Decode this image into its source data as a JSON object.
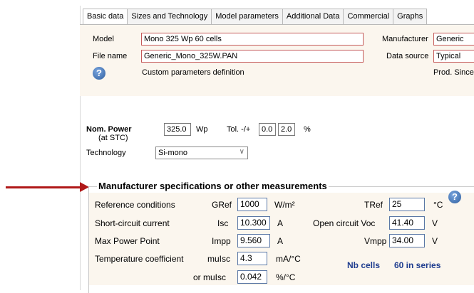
{
  "tabs": [
    "Basic data",
    "Sizes and Technology",
    "Model parameters",
    "Additional Data",
    "Commercial",
    "Graphs"
  ],
  "header": {
    "model_label": "Model",
    "model_value": "Mono 325 Wp  60 cells",
    "manufacturer_label": "Manufacturer",
    "manufacturer_value": "Generic",
    "file_label": "File name",
    "file_value": "Generic_Mono_325W.PAN",
    "data_source_label": "Data source",
    "data_source_value": "Typical",
    "custom_params_label": "Custom parameters definition",
    "prod_since_label": "Prod. Since"
  },
  "power": {
    "nom_power_label": "Nom. Power",
    "at_stc_label": "(at STC)",
    "nom_power_value": "325.0",
    "nom_power_unit": "Wp",
    "tol_label": "Tol. -/+",
    "tol_minus": "0.0",
    "tol_plus": "2.0",
    "tol_unit": "%",
    "technology_label": "Technology",
    "technology_value": "Si-mono"
  },
  "specs": {
    "title": "Manufacturer specifications or other measurements",
    "ref_conditions_label": "Reference conditions",
    "gref_label": "GRef",
    "gref_value": "1000",
    "gref_unit": "W/m²",
    "tref_label": "TRef",
    "tref_value": "25",
    "tref_unit": "°C",
    "isc_row_label": "Short-circuit current",
    "isc_label": "Isc",
    "isc_value": "10.300",
    "isc_unit": "A",
    "voc_label": "Open circuit Voc",
    "voc_value": "41.40",
    "voc_unit": "V",
    "mpp_row_label": "Max Power Point",
    "impp_label": "Impp",
    "impp_value": "9.560",
    "impp_unit": "A",
    "vmpp_label": "Vmpp",
    "vmpp_value": "34.00",
    "vmpp_unit": "V",
    "temp_coef_label": "Temperature coefficient",
    "muisc_label": "muIsc",
    "muisc_value": "4.3",
    "muisc_unit": "mA/°C",
    "or_muisc_label": "or muIsc",
    "muisc_pct_value": "0.042",
    "muisc_pct_unit": "%/°C",
    "nb_cells_label": "Nb cells",
    "nb_cells_value": "60 in series"
  },
  "colors": {
    "arrow": "#b01818",
    "panel_bg": "#fbf6ee",
    "accent_blue": "#1f3d8f"
  }
}
